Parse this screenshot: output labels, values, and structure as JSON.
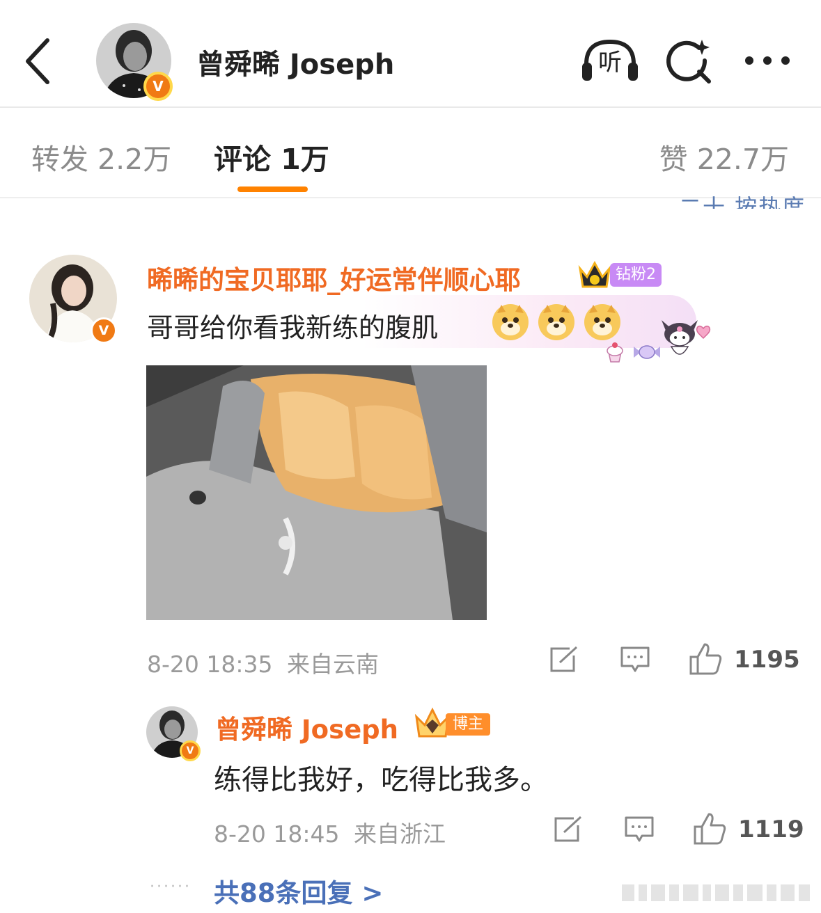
{
  "header": {
    "back_icon": "chevron-left-icon",
    "title": "曾舜晞 Joseph",
    "listen_label": "听",
    "icons": [
      "headphones-icon",
      "search-sparkle-icon",
      "more-icon"
    ]
  },
  "tabs": {
    "repost": "转发 2.2万",
    "comment": "评论 1万",
    "like": "赞 22.7万"
  },
  "sort_label": "二十 按热度",
  "comment": {
    "username": "晞晞的宝贝耶耶_好运常伴顺心耶",
    "fan_badge": "钻粉2",
    "text": "哥哥给你看我新练的腹肌",
    "emojis": [
      "doge-emoji",
      "doge-emoji",
      "doge-emoji"
    ],
    "timestamp": "8-20 18:35",
    "location": "来自云南",
    "like_count": "1195"
  },
  "reply": {
    "username": "曾舜晞 Joseph",
    "badge": "博主",
    "text": "练得比我好，吃得比我多。",
    "timestamp": "8-20 18:45",
    "location": "来自浙江",
    "like_count": "1119"
  },
  "more_replies": "共88条回复 >",
  "colors": {
    "accent": "#ff8200",
    "username": "#f06a23",
    "link": "#4a70b8",
    "fan_badge": "#c88af5",
    "muted": "#9a9a9a"
  }
}
